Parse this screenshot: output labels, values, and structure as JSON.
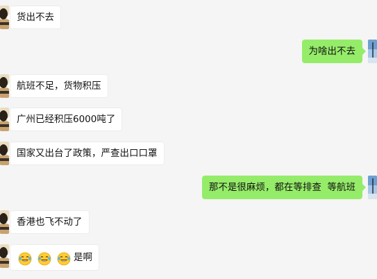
{
  "messages": [
    {
      "side": "left",
      "text": "货出不去"
    },
    {
      "side": "right",
      "text": "为啥出不去"
    },
    {
      "side": "left",
      "text": "航班不足，货物积压"
    },
    {
      "side": "left",
      "text": "广州已经积压6000吨了"
    },
    {
      "side": "left",
      "text": "国家又出台了政策，严查出口口罩"
    },
    {
      "side": "right",
      "text": "那不是很麻烦，都在等排查  等航班"
    },
    {
      "side": "left",
      "text": "香港也飞不动了"
    },
    {
      "side": "left",
      "text": "是啊",
      "emojis": [
        "tears-of-joy-icon",
        "tears-of-joy-icon",
        "tears-of-joy-icon"
      ]
    }
  ],
  "colors": {
    "background": "#f5f5f5",
    "incoming_bubble": "#ffffff",
    "outgoing_bubble": "#95ec69"
  }
}
